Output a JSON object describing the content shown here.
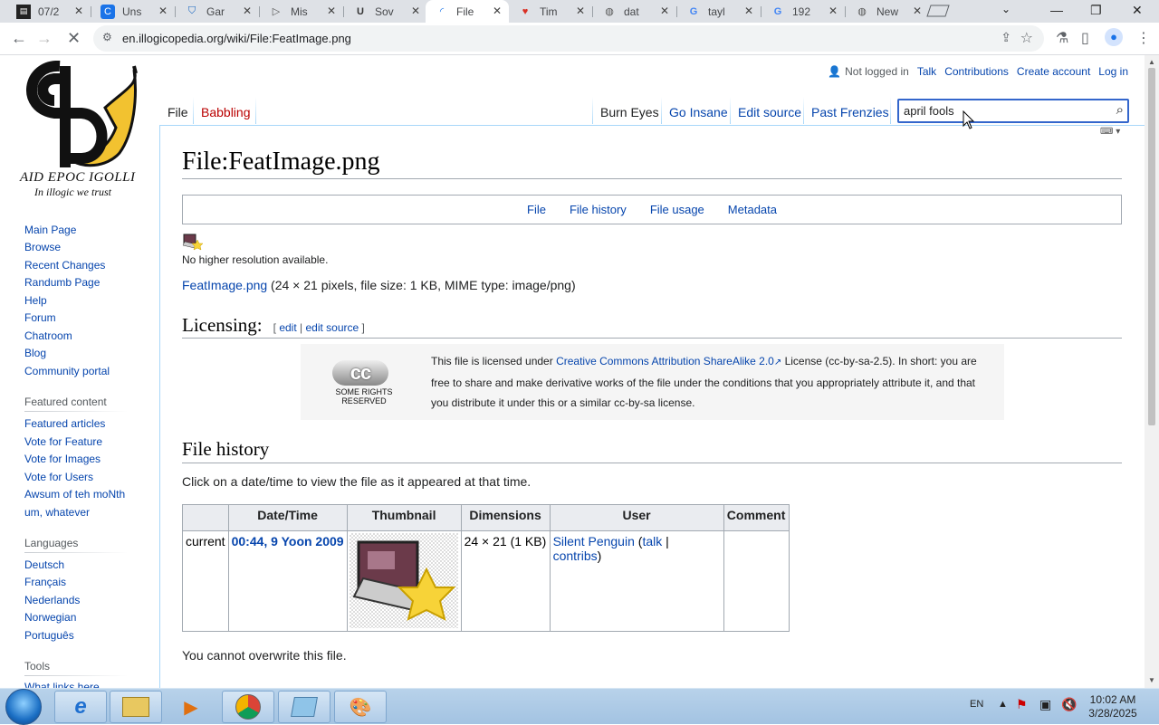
{
  "browser": {
    "tabs": [
      {
        "label": "07/2",
        "icon": "reader-favicon",
        "active": false
      },
      {
        "label": "Uns",
        "icon": "blue-c-favicon",
        "active": false
      },
      {
        "label": "Gar",
        "icon": "shield-favicon",
        "active": false
      },
      {
        "label": "Mis",
        "icon": "play-favicon",
        "active": false
      },
      {
        "label": "Sov",
        "icon": "u-favicon",
        "active": false
      },
      {
        "label": "File",
        "icon": "loading-spinner",
        "active": true
      },
      {
        "label": "Tim",
        "icon": "heart-favicon",
        "active": false
      },
      {
        "label": "dat",
        "icon": "globe-favicon",
        "active": false
      },
      {
        "label": "tayl",
        "icon": "google-favicon",
        "active": false
      },
      {
        "label": "192",
        "icon": "google-favicon",
        "active": false
      },
      {
        "label": "New",
        "icon": "globe-favicon",
        "active": false
      }
    ],
    "url": "en.illogicopedia.org/wiki/File:FeatImage.png"
  },
  "wiki": {
    "logo": {
      "line1": "AID EPOC IGOLLI",
      "line2": "In illogic we trust"
    },
    "nav_main": [
      "Main Page",
      "Browse",
      "Recent Changes",
      "Randumb Page",
      "Help",
      "Forum",
      "Chatroom",
      "Blog",
      "Community portal"
    ],
    "featured_heading": "Featured content",
    "nav_featured": [
      "Featured articles",
      "Vote for Feature",
      "Vote for Images",
      "Vote for Users",
      "Awsum of teh moNth",
      "um, whatever"
    ],
    "languages_heading": "Languages",
    "nav_languages": [
      "Deutsch",
      "Français",
      "Nederlands",
      "Norwegian",
      "Português"
    ],
    "tools_heading": "Tools",
    "tools_partial": "What links here",
    "personal": {
      "status": "Not logged in",
      "talk": "Talk",
      "contributions": "Contributions",
      "create": "Create account",
      "login": "Log in"
    },
    "tabs_left": {
      "file": "File",
      "babbling": "Babbling"
    },
    "tabs_right": {
      "burn": "Burn Eyes",
      "insane": "Go Insane",
      "edit_source": "Edit source",
      "past": "Past Frenzies"
    },
    "search": {
      "value": "april fools"
    },
    "title": "File:FeatImage.png",
    "filetoc": [
      "File",
      "File history",
      "File usage",
      "Metadata"
    ],
    "no_higher_res": "No higher resolution available.",
    "file_link": "FeatImage.png",
    "file_info": " (24 × 21 pixels, file size: 1 KB, MIME type: image/png)",
    "licensing": {
      "heading": "Licensing:",
      "edit_open": "[ ",
      "edit": "edit",
      "sep": " | ",
      "edit_source": "edit source",
      "edit_close": " ]",
      "cc_logo_text": "SOME RIGHTS RESERVED",
      "text_pre": "This file is licensed under ",
      "license_link": "Creative Commons Attribution ShareAlike 2.0",
      "text_post": " License (cc-by-sa-2.5). In short: you are free to share and make derivative works of the file under the conditions that you appropriately attribute it, and that you distribute it under this or a similar cc-by-sa license."
    },
    "file_history": {
      "heading": "File history",
      "intro": "Click on a date/time to view the file as it appeared at that time.",
      "columns": [
        "",
        "Date/Time",
        "Thumbnail",
        "Dimensions",
        "User",
        "Comment"
      ],
      "row": {
        "status": "current",
        "datetime": "00:44, 9 Yoon 2009",
        "dimensions": "24 × 21 (1 KB)",
        "user": "Silent Penguin",
        "talk": "talk",
        "contribs": "contribs",
        "comment": ""
      }
    },
    "cannot_overwrite": "You cannot overwrite this file."
  },
  "taskbar": {
    "lang": "EN",
    "time": "10:02 AM",
    "date": "3/28/2025"
  }
}
